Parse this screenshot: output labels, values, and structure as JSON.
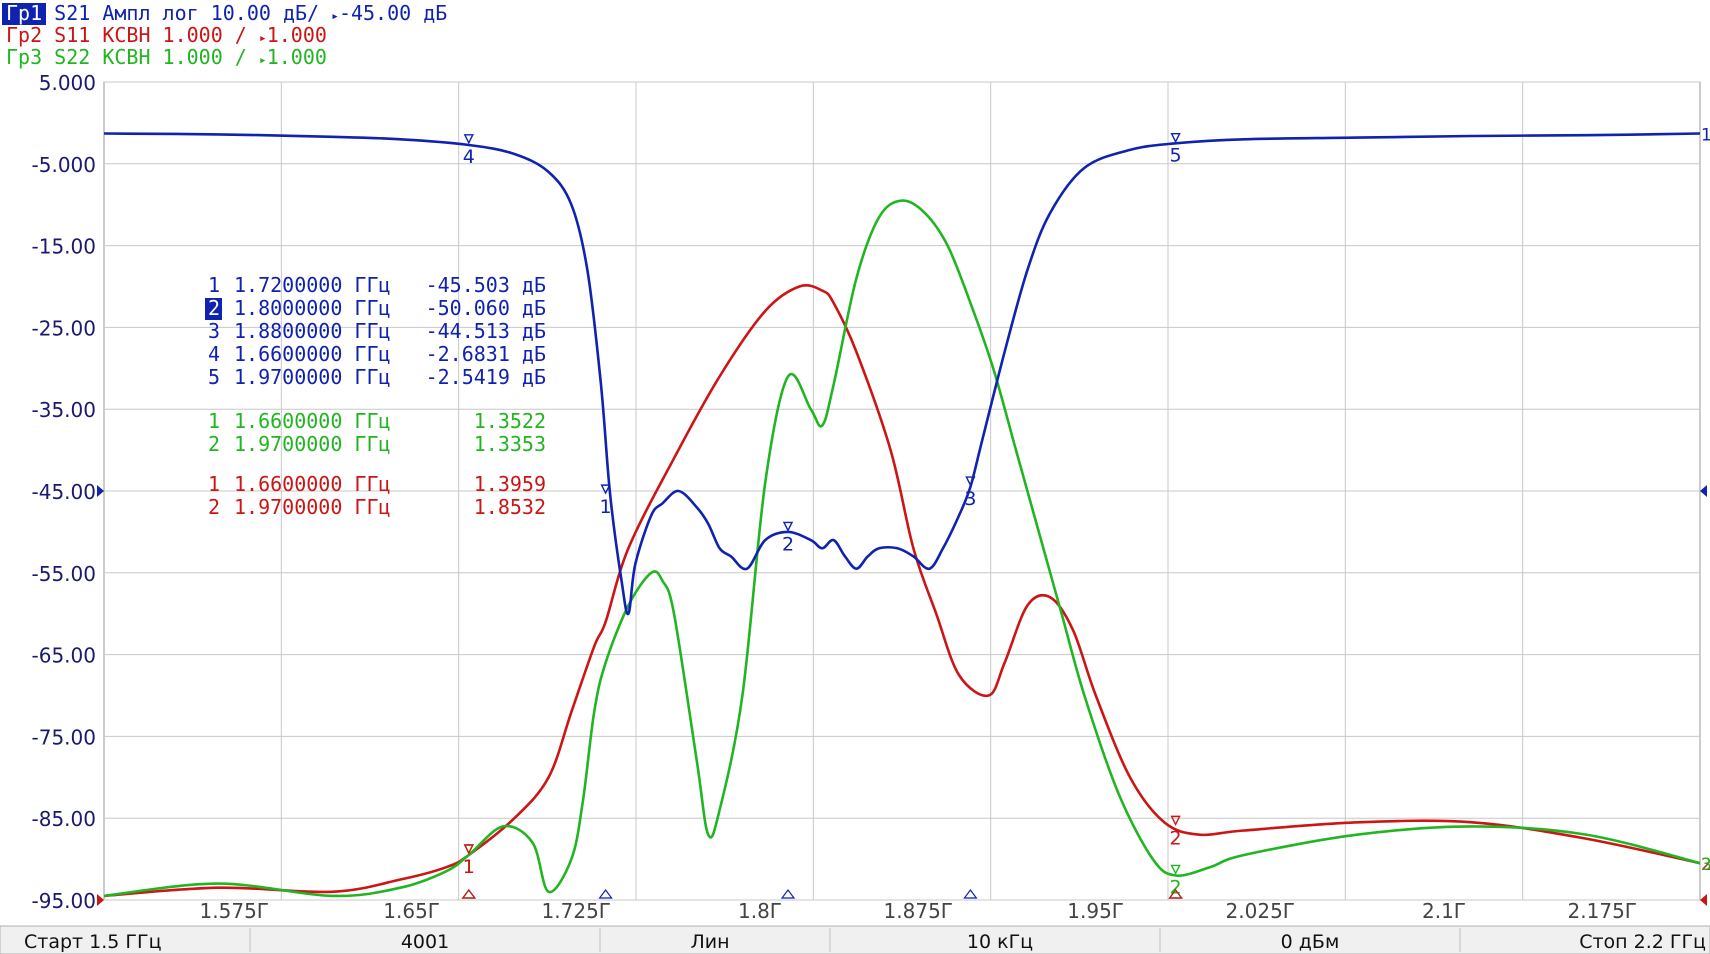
{
  "traces_header": [
    {
      "tag": "Гр1",
      "param": "S21",
      "fmt": "Ампл лог",
      "scale": "10.00 дБ/",
      "ref": "-45.00 дБ",
      "color": "#1022b0",
      "active": true
    },
    {
      "tag": "Гр2",
      "param": "S11",
      "fmt": "КСВН",
      "scale": "1.000 /",
      "ref": "1.000",
      "color": "#cc1515",
      "active": false
    },
    {
      "tag": "Гр3",
      "param": "S22",
      "fmt": "КСВН",
      "scale": "1.000 /",
      "ref": "1.000",
      "color": "#22b522",
      "active": false
    }
  ],
  "markers": {
    "blue": [
      {
        "n": "1",
        "freq": "1.7200000 ГГц",
        "val": "-45.503 дБ",
        "active": false
      },
      {
        "n": "2",
        "freq": "1.8000000 ГГц",
        "val": "-50.060 дБ",
        "active": true
      },
      {
        "n": "3",
        "freq": "1.8800000 ГГц",
        "val": "-44.513 дБ",
        "active": false
      },
      {
        "n": "4",
        "freq": "1.6600000 ГГц",
        "val": "-2.6831 дБ",
        "active": false
      },
      {
        "n": "5",
        "freq": "1.9700000 ГГц",
        "val": "-2.5419 дБ",
        "active": false
      }
    ],
    "green": [
      {
        "n": "1",
        "freq": "1.6600000 ГГц",
        "val": "1.3522"
      },
      {
        "n": "2",
        "freq": "1.9700000 ГГц",
        "val": "1.3353"
      }
    ],
    "red": [
      {
        "n": "1",
        "freq": "1.6600000 ГГц",
        "val": "1.3959"
      },
      {
        "n": "2",
        "freq": "1.9700000 ГГц",
        "val": "1.8532"
      }
    ]
  },
  "status_bar": {
    "start": "Старт 1.5 ГГц",
    "points": "4001",
    "sweep": "Лин",
    "ifbw": "10 кГц",
    "power": "0 дБм",
    "stop": "Стоп 2.2 ГГц"
  },
  "colors": {
    "s21": "#1022b0",
    "s11": "#cc1515",
    "s22": "#22b522",
    "grid": "#c8c8c8",
    "axis_text": "#1a1a6e"
  },
  "chart_data": {
    "type": "line",
    "xlim": [
      1.5,
      2.2
    ],
    "ylim": [
      -95,
      5
    ],
    "x_tick_labels": [
      {
        "x": 1.575,
        "label": "1.575Г"
      },
      {
        "x": 1.65,
        "label": "1.65Г"
      },
      {
        "x": 1.725,
        "label": "1.725Г"
      },
      {
        "x": 1.8,
        "label": "1.8Г"
      },
      {
        "x": 1.875,
        "label": "1.875Г"
      },
      {
        "x": 1.95,
        "label": "1.95Г"
      },
      {
        "x": 2.025,
        "label": "2.025Г"
      },
      {
        "x": 2.1,
        "label": "2.1Г"
      },
      {
        "x": 2.175,
        "label": "2.175Г"
      }
    ],
    "y_tick_labels": [
      {
        "y": 5,
        "label": "5.000"
      },
      {
        "y": -5,
        "label": "-5.000"
      },
      {
        "y": -15,
        "label": "-15.00"
      },
      {
        "y": -25,
        "label": "-25.00"
      },
      {
        "y": -35,
        "label": "-35.00"
      },
      {
        "y": -45,
        "label": "-45.00"
      },
      {
        "y": -55,
        "label": "-55.00"
      },
      {
        "y": -65,
        "label": "-65.00"
      },
      {
        "y": -75,
        "label": "-75.00"
      },
      {
        "y": -85,
        "label": "-85.00"
      },
      {
        "y": -95,
        "label": "-95.00"
      }
    ],
    "grid": true,
    "series": [
      {
        "name": "S21",
        "color": "#1022b0",
        "x": [
          1.5,
          1.55,
          1.6,
          1.63,
          1.66,
          1.68,
          1.695,
          1.705,
          1.712,
          1.718,
          1.722,
          1.727,
          1.73,
          1.733,
          1.74,
          1.745,
          1.752,
          1.76,
          1.765,
          1.77,
          1.775,
          1.782,
          1.79,
          1.8,
          1.81,
          1.815,
          1.82,
          1.825,
          1.83,
          1.835,
          1.84,
          1.848,
          1.855,
          1.862,
          1.868,
          1.875,
          1.88,
          1.885,
          1.895,
          1.905,
          1.915,
          1.93,
          1.95,
          1.97,
          2.0,
          2.05,
          2.1,
          2.15,
          2.2
        ],
        "y": [
          -1.3,
          -1.4,
          -1.7,
          -2.0,
          -2.7,
          -3.8,
          -6.0,
          -10.0,
          -18.0,
          -32.0,
          -45.5,
          -56.0,
          -60.0,
          -54.0,
          -48.0,
          -46.5,
          -45.0,
          -47.0,
          -49.0,
          -52.0,
          -53.0,
          -54.5,
          -51.0,
          -50.0,
          -51.0,
          -52.0,
          -51.0,
          -53.0,
          -54.5,
          -53.0,
          -52.0,
          -52.0,
          -53.0,
          -54.5,
          -52.0,
          -48.0,
          -44.5,
          -39.0,
          -28.0,
          -18.0,
          -11.0,
          -5.5,
          -3.3,
          -2.5,
          -2.0,
          -1.8,
          -1.6,
          -1.5,
          -1.3
        ]
      },
      {
        "name": "S11",
        "color": "#cc1515",
        "x": [
          1.5,
          1.55,
          1.6,
          1.63,
          1.65,
          1.66,
          1.68,
          1.695,
          1.705,
          1.715,
          1.72,
          1.73,
          1.75,
          1.77,
          1.79,
          1.805,
          1.815,
          1.82,
          1.83,
          1.845,
          1.855,
          1.865,
          1.875,
          1.888,
          1.895,
          1.905,
          1.915,
          1.925,
          1.935,
          1.95,
          1.965,
          1.98,
          2.0,
          2.05,
          2.1,
          2.15,
          2.2
        ],
        "y": [
          -94.5,
          -93.5,
          -94.0,
          -92.5,
          -91.0,
          -89.5,
          -85.0,
          -80.0,
          -72.0,
          -64.0,
          -61.0,
          -52.0,
          -41.0,
          -31.0,
          -23.0,
          -20.0,
          -20.5,
          -22.0,
          -28.0,
          -40.0,
          -52.0,
          -60.0,
          -67.5,
          -70.0,
          -66.0,
          -59.0,
          -58.0,
          -62.0,
          -70.0,
          -80.0,
          -85.5,
          -87.0,
          -86.5,
          -85.5,
          -85.5,
          -87.5,
          -90.5
        ]
      },
      {
        "name": "S22",
        "color": "#22b522",
        "x": [
          1.5,
          1.55,
          1.6,
          1.63,
          1.65,
          1.66,
          1.675,
          1.688,
          1.695,
          1.705,
          1.71,
          1.715,
          1.72,
          1.73,
          1.74,
          1.745,
          1.75,
          1.76,
          1.765,
          1.77,
          1.78,
          1.79,
          1.8,
          1.81,
          1.815,
          1.82,
          1.83,
          1.84,
          1.85,
          1.86,
          1.87,
          1.88,
          1.89,
          1.9,
          1.91,
          1.92,
          1.93,
          1.945,
          1.96,
          1.97,
          1.985,
          2.0,
          2.05,
          2.1,
          2.15,
          2.2
        ],
        "y": [
          -94.5,
          -93.0,
          -94.5,
          -93.5,
          -91.5,
          -89.5,
          -86.0,
          -88.0,
          -94.0,
          -90.0,
          -83.0,
          -72.0,
          -66.0,
          -59.0,
          -55.0,
          -56.0,
          -60.0,
          -78.0,
          -87.0,
          -84.0,
          -70.0,
          -44.0,
          -31.0,
          -35.0,
          -37.0,
          -32.0,
          -19.0,
          -11.5,
          -9.5,
          -11.0,
          -15.0,
          -22.0,
          -30.0,
          -40.0,
          -50.0,
          -60.0,
          -70.0,
          -82.0,
          -90.0,
          -92.0,
          -91.0,
          -89.5,
          -87.0,
          -86.0,
          -87.0,
          -90.5
        ]
      }
    ],
    "markers": [
      {
        "series": "S21",
        "label": "1",
        "x": 1.72,
        "y": -45.503
      },
      {
        "series": "S21",
        "label": "2",
        "x": 1.8,
        "y": -50.06
      },
      {
        "series": "S21",
        "label": "3",
        "x": 1.88,
        "y": -44.513
      },
      {
        "series": "S21",
        "label": "4",
        "x": 1.66,
        "y": -2.6831
      },
      {
        "series": "S21",
        "label": "5",
        "x": 1.97,
        "y": -2.5419
      },
      {
        "series": "S22",
        "label": "1",
        "x": 1.66,
        "y": 1.3522
      },
      {
        "series": "S22",
        "label": "2",
        "x": 1.97,
        "y": 1.3353
      },
      {
        "series": "S11",
        "label": "1",
        "x": 1.66,
        "y": 1.3959
      },
      {
        "series": "S11",
        "label": "2",
        "x": 1.97,
        "y": 1.8532
      }
    ],
    "end_labels": [
      "1",
      "2",
      "3"
    ]
  }
}
